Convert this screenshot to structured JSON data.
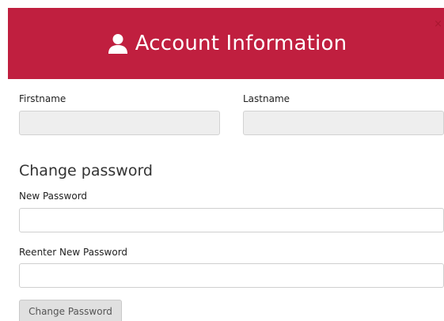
{
  "header": {
    "icon": "user-icon",
    "title": "Account Information",
    "close": "×",
    "color": "#c01f3f"
  },
  "profile": {
    "firstname_label": "Firstname",
    "firstname_value": "",
    "lastname_label": "Lastname",
    "lastname_value": ""
  },
  "password": {
    "section_title": "Change password",
    "new_label": "New Password",
    "new_value": "",
    "reenter_label": "Reenter New Password",
    "reenter_value": "",
    "submit_label": "Change Password"
  }
}
